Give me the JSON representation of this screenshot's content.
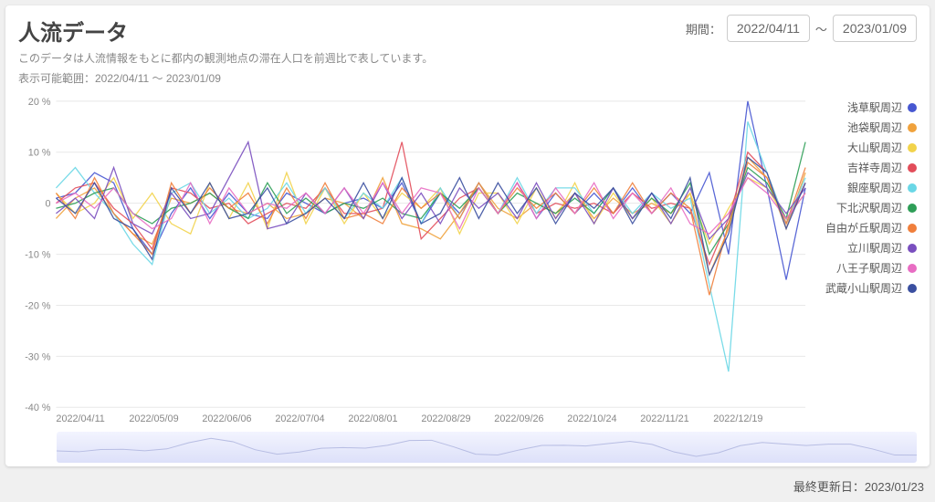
{
  "header": {
    "title": "人流データ",
    "description": "このデータは人流情報をもとに都内の観測地点の滞在人口を前週比で表しています。",
    "range_note": "表示可能範囲：2022/04/11 ～ 2023/01/09",
    "period_label": "期間：",
    "date_from": "2022/04/11",
    "date_sep": "～",
    "date_to": "2023/01/09"
  },
  "footer": {
    "label": "最終更新日：",
    "value": "2023/01/23"
  },
  "chart_data": {
    "type": "line",
    "ylabel": "%",
    "ylim": [
      -40,
      20
    ],
    "yticks": [
      -40,
      -30,
      -20,
      -10,
      0,
      10,
      20
    ],
    "ytick_labels": [
      "-40 %",
      "-30 %",
      "-20 %",
      "-10 %",
      "0",
      "10 %",
      "20 %"
    ],
    "xticks": [
      "2022/04/11",
      "2022/05/09",
      "2022/06/06",
      "2022/07/04",
      "2022/08/01",
      "2022/08/29",
      "2022/09/26",
      "2022/10/24",
      "2022/11/21",
      "2022/12/19"
    ],
    "n_points": 40,
    "series": [
      {
        "name": "浅草駅周辺",
        "color": "#4757d1",
        "values": [
          1,
          2,
          6,
          4,
          -5,
          -10,
          -2,
          3,
          -3,
          2,
          -2,
          -3,
          2,
          0,
          -2,
          0,
          1,
          -1,
          4,
          -4,
          2,
          -2,
          3,
          -2,
          4,
          -3,
          2,
          -2,
          2,
          -2,
          3,
          -2,
          2,
          -2,
          6,
          -10,
          20,
          3,
          -15,
          3
        ]
      },
      {
        "name": "池袋駅周辺",
        "color": "#f0a23c",
        "values": [
          -3,
          1,
          3,
          -2,
          -6,
          -8,
          1,
          0,
          2,
          -1,
          -2,
          0,
          -3,
          -2,
          1,
          0,
          -3,
          5,
          -4,
          -5,
          -7,
          -2,
          4,
          -1,
          -3,
          0,
          -2,
          2,
          -3,
          1,
          -2,
          0,
          -2,
          2,
          -14,
          -5,
          9,
          5,
          -5,
          6
        ]
      },
      {
        "name": "大山駅周辺",
        "color": "#f2d34b",
        "values": [
          2,
          -2,
          0,
          5,
          -3,
          2,
          -4,
          -6,
          4,
          -3,
          4,
          -5,
          6,
          -4,
          3,
          -4,
          2,
          -3,
          2,
          -1,
          3,
          -6,
          2,
          2,
          -4,
          3,
          -3,
          4,
          -4,
          2,
          -3,
          1,
          -4,
          2,
          -8,
          -1,
          5,
          3,
          -3,
          2
        ]
      },
      {
        "name": "吉祥寺周辺",
        "color": "#e24d5a",
        "values": [
          0,
          3,
          4,
          -1,
          -4,
          -9,
          3,
          2,
          -1,
          0,
          -4,
          -2,
          0,
          -1,
          3,
          -2,
          -2,
          -1,
          12,
          -7,
          -3,
          1,
          3,
          -2,
          4,
          -2,
          0,
          -1,
          0,
          -2,
          2,
          -1,
          0,
          -1,
          -12,
          -3,
          10,
          6,
          -4,
          4
        ]
      },
      {
        "name": "銀座駅周辺",
        "color": "#6ad7e6",
        "values": [
          3,
          7,
          2,
          -2,
          -8,
          -12,
          2,
          4,
          -2,
          1,
          -3,
          -1,
          4,
          -2,
          3,
          -3,
          2,
          -1,
          5,
          -4,
          3,
          -3,
          4,
          -2,
          5,
          -2,
          3,
          3,
          -2,
          3,
          -2,
          2,
          -1,
          1,
          -16,
          -33,
          16,
          6,
          -4,
          5
        ]
      },
      {
        "name": "下北沢駅周辺",
        "color": "#2e9e57",
        "values": [
          -1,
          0,
          2,
          3,
          -2,
          -4,
          -1,
          0,
          2,
          -1,
          -3,
          4,
          -2,
          1,
          -2,
          0,
          -1,
          1,
          -2,
          -3,
          2,
          -1,
          3,
          -2,
          2,
          0,
          -2,
          1,
          -2,
          3,
          -3,
          1,
          -2,
          4,
          -10,
          -4,
          7,
          4,
          -3,
          12
        ]
      },
      {
        "name": "自由が丘駅周辺",
        "color": "#f07f3c",
        "values": [
          2,
          -3,
          5,
          -2,
          -6,
          -10,
          4,
          -2,
          3,
          -1,
          2,
          -4,
          3,
          -3,
          4,
          -3,
          -2,
          -4,
          3,
          -1,
          2,
          -3,
          4,
          -2,
          3,
          -1,
          2,
          -2,
          3,
          -2,
          4,
          -2,
          2,
          -1,
          -18,
          -4,
          8,
          5,
          -4,
          7
        ]
      },
      {
        "name": "立川駅周辺",
        "color": "#7a4fbf",
        "values": [
          -2,
          1,
          -3,
          7,
          -4,
          -6,
          2,
          -3,
          -2,
          5,
          12,
          -5,
          -4,
          2,
          -2,
          3,
          -3,
          4,
          -3,
          2,
          -4,
          3,
          -1,
          2,
          -3,
          4,
          -3,
          2,
          -4,
          3,
          -3,
          2,
          -4,
          3,
          -7,
          -3,
          6,
          3,
          -2,
          3
        ]
      },
      {
        "name": "八王子駅周辺",
        "color": "#e86dc3",
        "values": [
          0,
          2,
          -1,
          3,
          -2,
          -5,
          -3,
          4,
          -4,
          3,
          -2,
          0,
          -1,
          2,
          -2,
          3,
          -2,
          4,
          -2,
          3,
          2,
          -5,
          3,
          -2,
          4,
          -3,
          3,
          -2,
          4,
          -3,
          2,
          -2,
          3,
          -4,
          -6,
          -2,
          5,
          2,
          -3,
          2
        ]
      },
      {
        "name": "武蔵小山駅周辺",
        "color": "#3a4fa0",
        "values": [
          1,
          -2,
          4,
          -3,
          -5,
          -11,
          3,
          -2,
          4,
          -3,
          -2,
          3,
          -4,
          -2,
          1,
          -3,
          4,
          -3,
          5,
          -4,
          -2,
          5,
          -3,
          4,
          -2,
          3,
          -4,
          2,
          -1,
          3,
          -4,
          2,
          -3,
          5,
          -14,
          -6,
          9,
          6,
          -5,
          4
        ]
      }
    ]
  }
}
